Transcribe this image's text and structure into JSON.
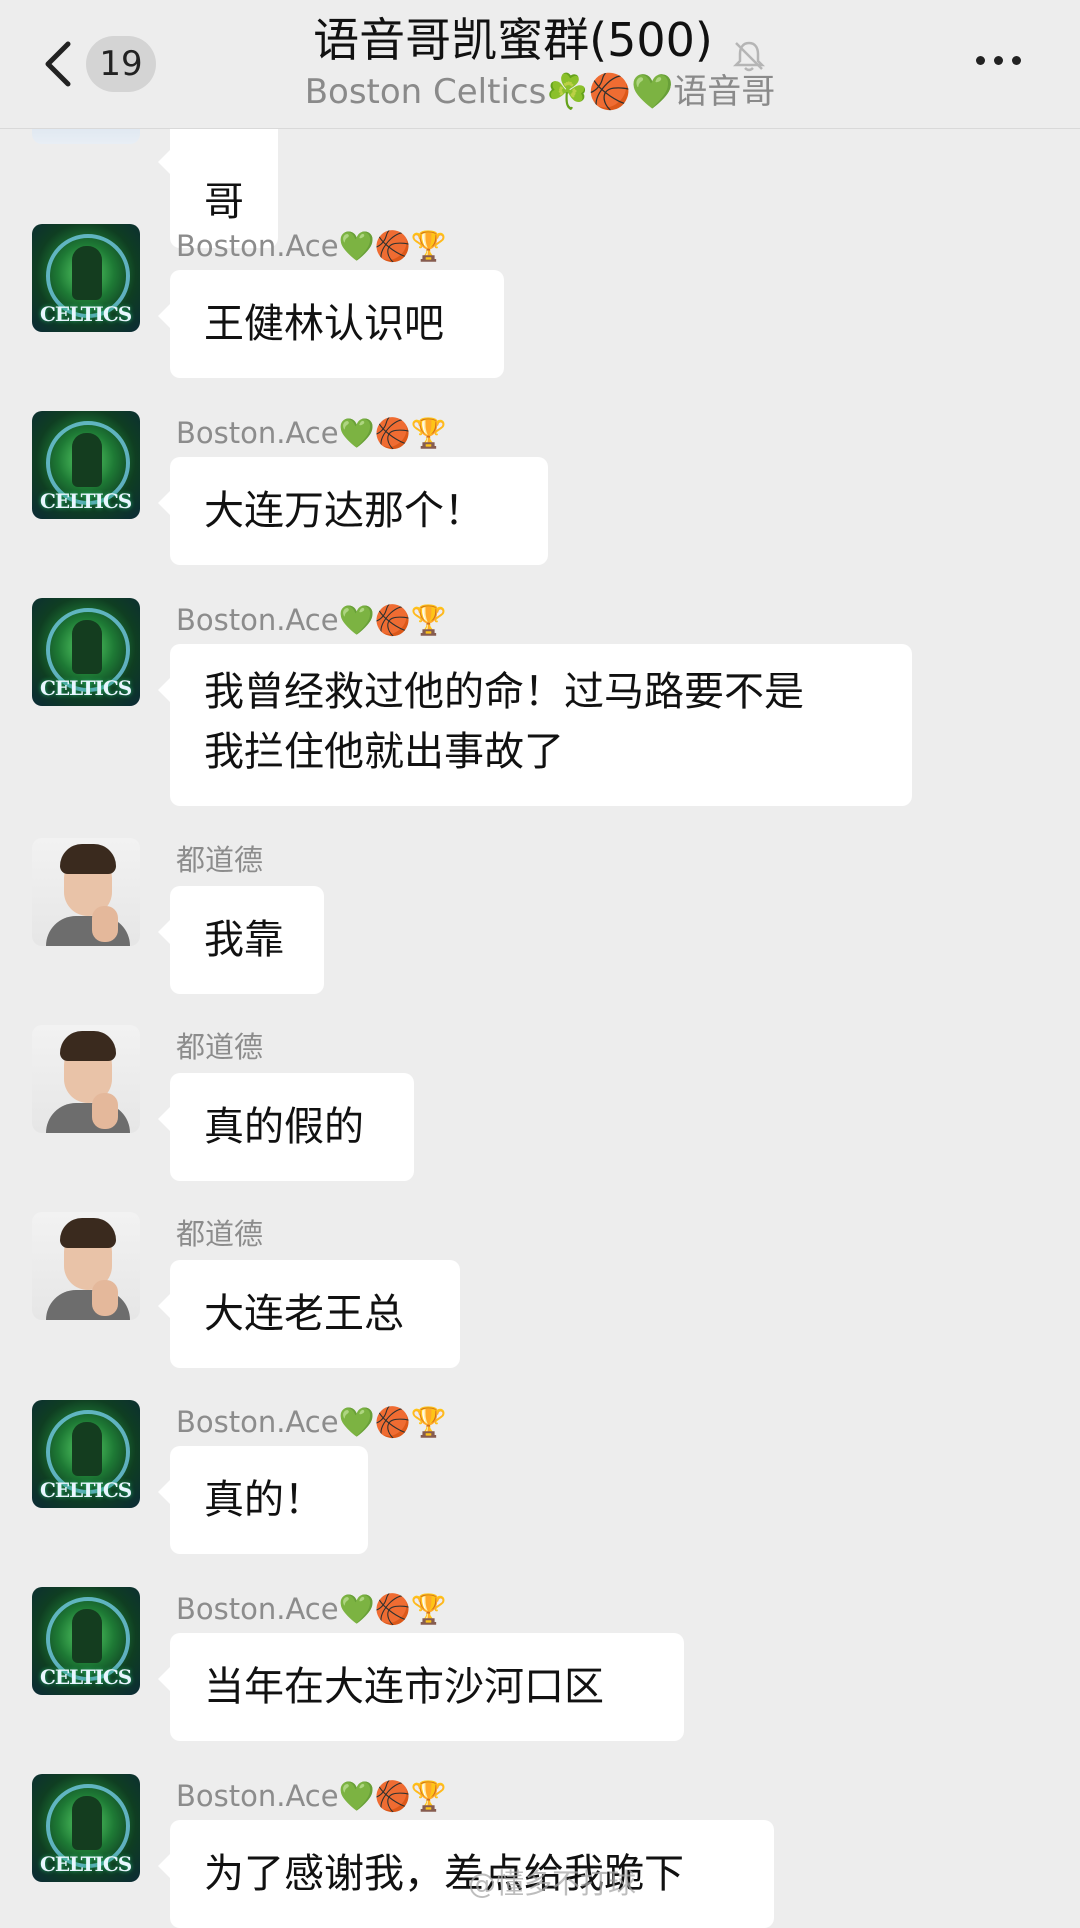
{
  "header": {
    "back_label": "<",
    "unread_count": "19",
    "title": "语音哥凯蜜群(500)",
    "subtitle": "Boston Celtics☘️🏀💚语音哥",
    "more_label": "..."
  },
  "messages": [
    {
      "sender": "",
      "avatar": "partial",
      "text": "哥"
    },
    {
      "sender": "Boston.Ace💚🏀🏆",
      "avatar": "celtics",
      "text": "王健林认识吧"
    },
    {
      "sender": "Boston.Ace💚🏀🏆",
      "avatar": "celtics",
      "text": "大连万达那个！"
    },
    {
      "sender": "Boston.Ace💚🏀🏆",
      "avatar": "celtics",
      "text": "我曾经救过他的命！过马路要不是\n我拦住他就出事故了"
    },
    {
      "sender": "都道德",
      "avatar": "boy",
      "text": "我靠"
    },
    {
      "sender": "都道德",
      "avatar": "boy",
      "text": "真的假的"
    },
    {
      "sender": "都道德",
      "avatar": "boy",
      "text": "大连老王总"
    },
    {
      "sender": "Boston.Ace💚🏀🏆",
      "avatar": "celtics",
      "text": "真的！"
    },
    {
      "sender": "Boston.Ace💚🏀🏆",
      "avatar": "celtics",
      "text": "当年在大连市沙河口区"
    },
    {
      "sender": "Boston.Ace💚🏀🏆",
      "avatar": "celtics",
      "text": "为了感谢我，差点给我跪下"
    }
  ],
  "celtics_avatar_text": "CELTICS",
  "watermark": "@懂多不打球"
}
